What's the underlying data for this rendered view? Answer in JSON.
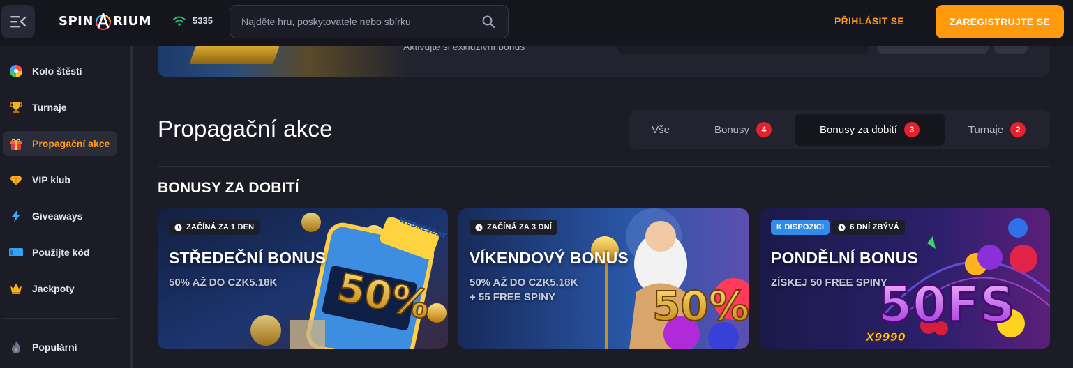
{
  "header": {
    "logo_text_left": "SPIN",
    "logo_text_right": "RIUM",
    "online_count": "5335",
    "search_placeholder": "Najděte hru, poskytovatele nebo sbírku",
    "login_label": "PŘIHLÁSIT SE",
    "register_label": "ZAREGISTRUJTE SE"
  },
  "sidebar": {
    "items": [
      {
        "label": "Kolo štěstí",
        "icon": "wheel-icon"
      },
      {
        "label": "Turnaje",
        "icon": "trophy-icon"
      },
      {
        "label": "Propagační akce",
        "icon": "gift-icon",
        "active": true
      },
      {
        "label": "VIP klub",
        "icon": "diamond-icon"
      },
      {
        "label": "Giveaways",
        "icon": "lightning-icon"
      },
      {
        "label": "Použijte kód",
        "icon": "ticket-icon"
      },
      {
        "label": "Jackpoty",
        "icon": "crown-icon"
      },
      {
        "label": "Populární",
        "icon": "fire-icon"
      }
    ]
  },
  "banner": {
    "text": "Aktivujte si exkluzivní bonus"
  },
  "main": {
    "title": "Propagační akce",
    "tabs": [
      {
        "label": "Vše",
        "badge": ""
      },
      {
        "label": "Bonusy",
        "badge": "4"
      },
      {
        "label": "Bonusy za dobití",
        "badge": "3",
        "active": true
      },
      {
        "label": "Turnaje",
        "badge": "2"
      }
    ],
    "section_title": "BONUSY ZA DOBITÍ",
    "cards": [
      {
        "tags": [
          {
            "text": "ZAČÍNÁ ZA 1 DEN",
            "clock": true
          }
        ],
        "title": "STŘEDEČNÍ BONUS",
        "sub": [
          "50% AŽ DO CZK5.18K"
        ],
        "art_text": "50%",
        "art_badge": "WEDNESDAY BONUS"
      },
      {
        "tags": [
          {
            "text": "ZAČÍNÁ ZA 3 DNÍ",
            "clock": true
          }
        ],
        "title": "VÍKENDOVÝ BONUS",
        "sub": [
          "50% AŽ DO CZK5.18K",
          "+ 55 FREE SPINY"
        ],
        "art_text": "50%"
      },
      {
        "tags": [
          {
            "text": "K DISPOZICI",
            "clock": false,
            "available": true
          },
          {
            "text": "6 DNÍ ZBÝVÁ",
            "clock": true
          }
        ],
        "title": "PONDĚLNÍ BONUS",
        "sub": [
          "ZÍSKEJ 50 FREE SPINY"
        ],
        "art_text": "50FS",
        "art_sub": "X9990"
      }
    ]
  },
  "colors": {
    "accent": "#ff9a0e",
    "badge": "#e5212e",
    "available_tag": "#2f8ce9"
  }
}
